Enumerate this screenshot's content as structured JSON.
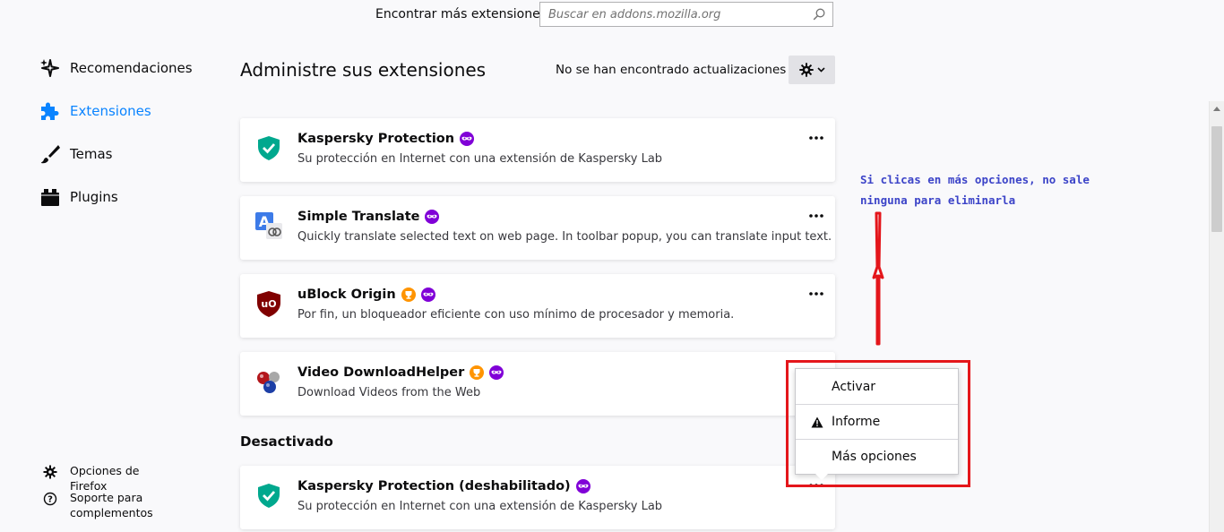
{
  "header": {
    "find_more_label": "Encontrar más extensiones",
    "search_placeholder": "Buscar en addons.mozilla.org"
  },
  "sidebar": {
    "items": [
      {
        "label": "Recomendaciones",
        "icon": "sparkle-icon"
      },
      {
        "label": "Extensiones",
        "icon": "puzzle-icon",
        "active": true
      },
      {
        "label": "Temas",
        "icon": "brush-icon"
      },
      {
        "label": "Plugins",
        "icon": "plugin-icon"
      }
    ],
    "footer": [
      {
        "label": "Opciones de Firefox",
        "icon": "gear-icon"
      },
      {
        "label": "Soporte para complementos",
        "icon": "help-icon"
      }
    ]
  },
  "main": {
    "title": "Administre sus extensiones",
    "update_status": "No se han encontrado actualizaciones"
  },
  "extensions": [
    {
      "name": "Kaspersky Protection",
      "desc": "Su protección en Internet con una extensión de Kaspersky Lab",
      "icon": "kaspersky-shield-icon"
    },
    {
      "name": "Simple Translate",
      "desc": "Quickly translate selected text on web page. In toolbar popup, you can translate input text.",
      "icon": "translate-icon"
    },
    {
      "name": "uBlock Origin",
      "desc": "Por fin, un bloqueador eficiente con uso mínimo de procesador y memoria.",
      "icon": "ublock-shield-icon"
    },
    {
      "name": "Video DownloadHelper",
      "desc": "Download Videos from the Web",
      "icon": "video-balls-icon"
    }
  ],
  "disabled_section": {
    "heading": "Desactivado",
    "items": [
      {
        "name": "Kaspersky Protection (deshabilitado)",
        "desc": "Su protección en Internet con una extensión de Kaspersky Lab",
        "icon": "kaspersky-shield-icon"
      }
    ]
  },
  "context_menu": {
    "items": [
      {
        "label": "Activar",
        "icon": ""
      },
      {
        "label": "Informe",
        "icon": "warning-icon"
      },
      {
        "label": "Más opciones",
        "icon": ""
      }
    ]
  },
  "annotation": {
    "text": "Si clicas en más opciones, no sale ninguna para eliminarla",
    "color": "#3c44c8",
    "box_color": "#e4161b"
  },
  "colors": {
    "accent": "#0a84ff",
    "private_badge": "#8000d7",
    "recommended_badge": "#ff9400"
  }
}
